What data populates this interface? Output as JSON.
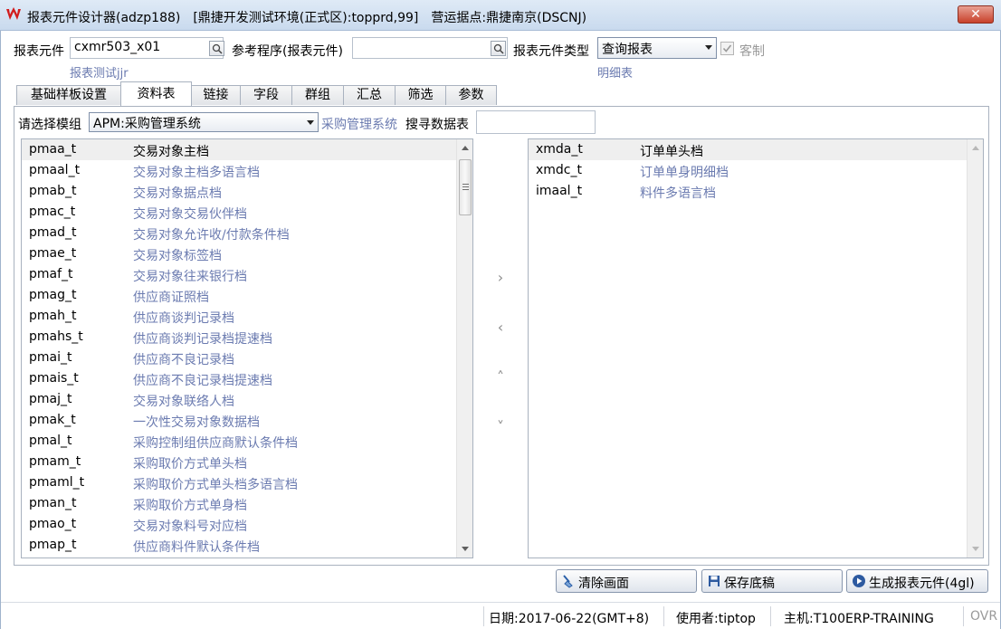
{
  "window": {
    "title": "报表元件设计器(adzp188)　[鼎捷开发测试环境(正式区):topprd,99]　营运据点:鼎捷南京(DSCNJ)",
    "close_symbol": "✕"
  },
  "form": {
    "element_label": "报表元件",
    "element_value": "cxmr503_x01",
    "element_sub": "报表测试jjr",
    "ref_label": "参考程序(报表元件)",
    "ref_value": "",
    "type_label": "报表元件类型",
    "type_value": "查询报表",
    "type_sub": "明细表",
    "custom_label": "客制",
    "custom_checked": true
  },
  "tabs": [
    {
      "label": "基础样板设置",
      "active": false
    },
    {
      "label": "资料表",
      "active": true
    },
    {
      "label": "链接",
      "active": false
    },
    {
      "label": "字段",
      "active": false
    },
    {
      "label": "群组",
      "active": false
    },
    {
      "label": "汇总",
      "active": false
    },
    {
      "label": "筛选",
      "active": false
    },
    {
      "label": "参数",
      "active": false
    }
  ],
  "module": {
    "label": "请选择模组",
    "value": "APM:采购管理系统",
    "sub": "采购管理系统",
    "search_label": "搜寻数据表",
    "search_value": ""
  },
  "available_tables": [
    {
      "code": "pmaa_t",
      "desc": "交易对象主档"
    },
    {
      "code": "pmaal_t",
      "desc": "交易对象主档多语言档"
    },
    {
      "code": "pmab_t",
      "desc": "交易对象据点档"
    },
    {
      "code": "pmac_t",
      "desc": "交易对象交易伙伴档"
    },
    {
      "code": "pmad_t",
      "desc": "交易对象允许收/付款条件档"
    },
    {
      "code": "pmae_t",
      "desc": "交易对象标签档"
    },
    {
      "code": "pmaf_t",
      "desc": "交易对象往来银行档"
    },
    {
      "code": "pmag_t",
      "desc": "供应商证照档"
    },
    {
      "code": "pmah_t",
      "desc": "供应商谈判记录档"
    },
    {
      "code": "pmahs_t",
      "desc": "供应商谈判记录档提速档"
    },
    {
      "code": "pmai_t",
      "desc": "供应商不良记录档"
    },
    {
      "code": "pmais_t",
      "desc": "供应商不良记录档提速档"
    },
    {
      "code": "pmaj_t",
      "desc": "交易对象联络人档"
    },
    {
      "code": "pmak_t",
      "desc": "一次性交易对象数据档"
    },
    {
      "code": "pmal_t",
      "desc": "采购控制组供应商默认条件档"
    },
    {
      "code": "pmam_t",
      "desc": "采购取价方式单头档"
    },
    {
      "code": "pmaml_t",
      "desc": "采购取价方式单头档多语言档"
    },
    {
      "code": "pman_t",
      "desc": "采购取价方式单身档"
    },
    {
      "code": "pmao_t",
      "desc": "交易对象料号对应档"
    },
    {
      "code": "pmap_t",
      "desc": "供应商料件默认条件档"
    }
  ],
  "selected_tables": [
    {
      "code": "xmda_t",
      "desc": "订单单头档"
    },
    {
      "code": "xmdc_t",
      "desc": "订单单身明细档"
    },
    {
      "code": "imaal_t",
      "desc": "料件多语言档"
    }
  ],
  "movers": {
    "add": "›",
    "remove": "‹",
    "up": "˄",
    "down": "˅"
  },
  "buttons": {
    "clear": "清除画面",
    "save": "保存底稿",
    "generate": "生成报表元件(4gl)"
  },
  "status": {
    "date": "日期:2017-06-22(GMT+8)",
    "user": "使用者:tiptop",
    "host": "主机:T100ERP-TRAINING",
    "mode": "OVR"
  }
}
